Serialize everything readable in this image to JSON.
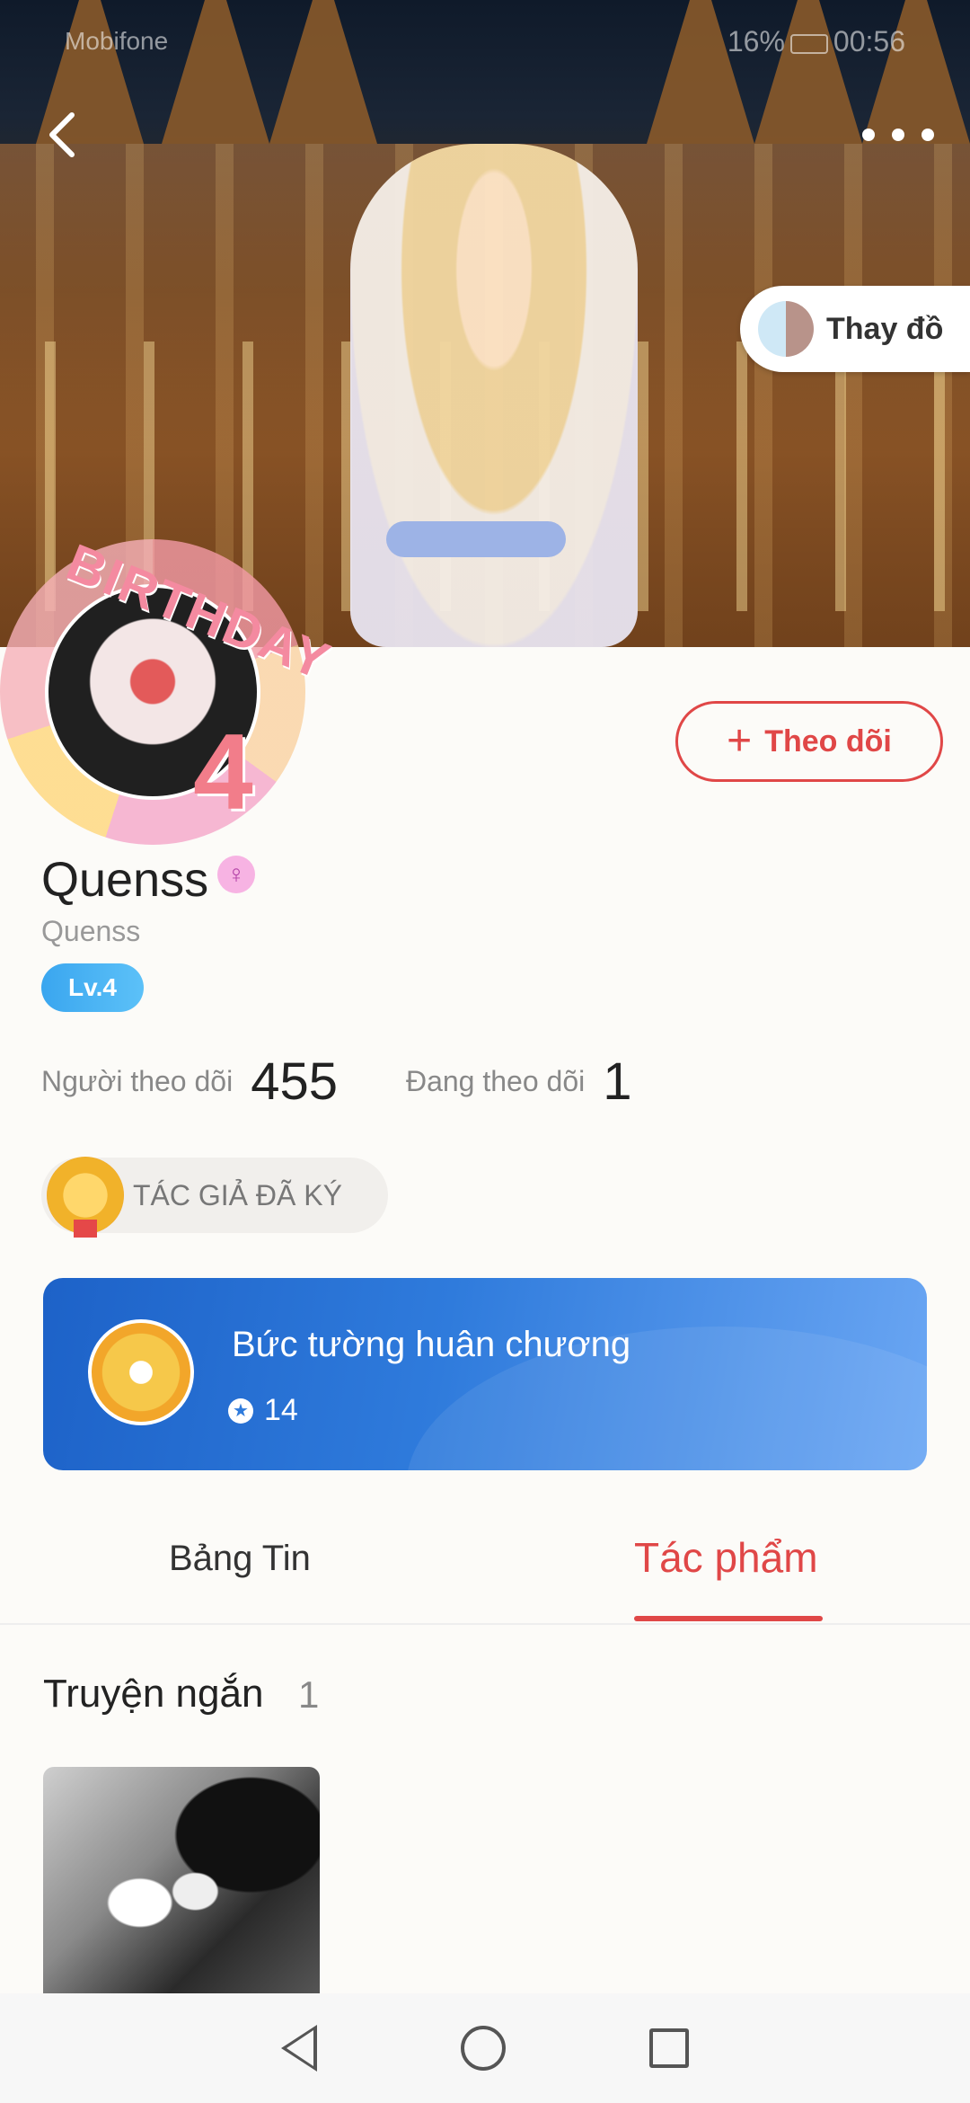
{
  "status_bar": {
    "carrier": "Mobifone",
    "battery": "16%",
    "time": "00:56"
  },
  "header": {
    "outfit_button_label": "Thay đồ"
  },
  "avatar_frame": {
    "text": "BIRTHDAY",
    "number": "4"
  },
  "profile": {
    "name": "Quenss",
    "handle": "Quenss",
    "level": "Lv.4",
    "follow_button_label": "Theo dõi",
    "followers_label": "Người theo dõi",
    "followers_count": "455",
    "following_label": "Đang theo dõi",
    "following_count": "1"
  },
  "author_badge": {
    "label": "TÁC GIẢ ĐÃ KÝ"
  },
  "medal_wall": {
    "title": "Bức tường huân chương",
    "count": "14"
  },
  "tabs": [
    {
      "label": "Bảng Tin",
      "active": false
    },
    {
      "label": "Tác phẩm",
      "active": true
    }
  ],
  "works_section": {
    "title": "Truyện ngắn",
    "count": "1"
  },
  "colors": {
    "accent": "#e04747",
    "medal_wall": "#2f7bdc",
    "level_badge": "#3aa6ef"
  },
  "icons": [
    "back-icon",
    "more-icon",
    "plus-icon",
    "gender-female-icon",
    "medal-icon",
    "star-icon"
  ]
}
